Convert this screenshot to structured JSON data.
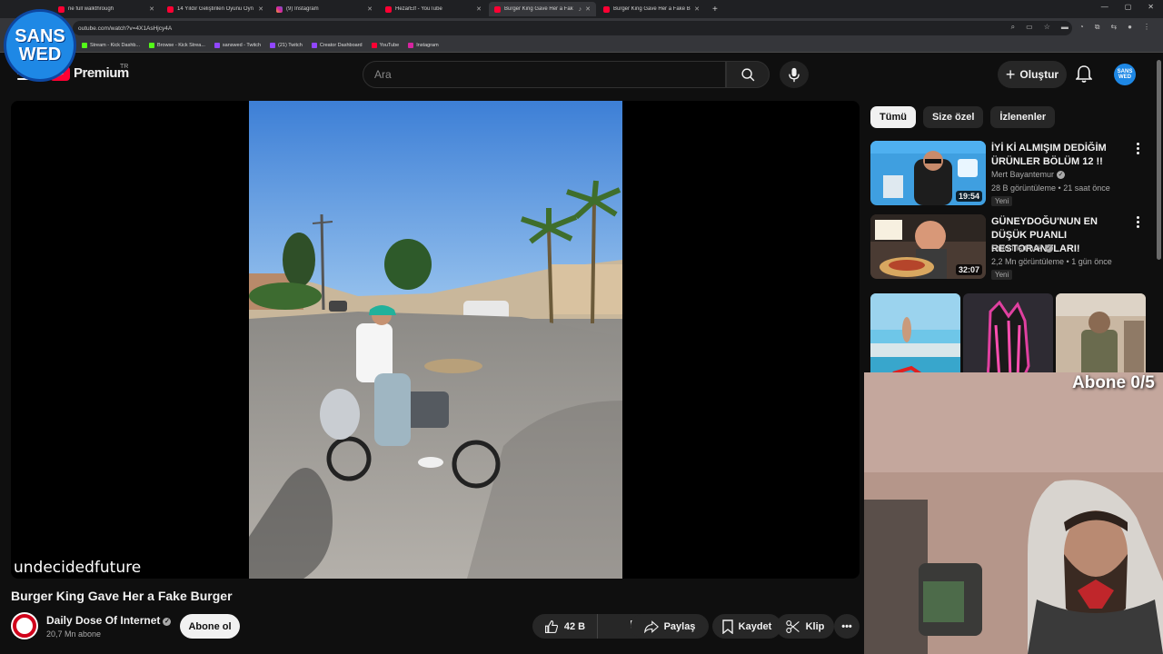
{
  "browser": {
    "tabs": [
      {
        "title": "ne full walkthrough",
        "icon": "youtube-icon"
      },
      {
        "title": "14 Yıldır Geliştirilen Oyunu Oyn",
        "icon": "youtube-icon"
      },
      {
        "title": "(9) Instagram",
        "icon": "instagram-icon"
      },
      {
        "title": "HezarElf - YouTube",
        "icon": "youtube-icon"
      },
      {
        "title": "Burger King Gave Her a Fak",
        "icon": "youtube-icon",
        "active": true
      },
      {
        "title": "Burger King Gave Her a Fake B",
        "icon": "youtube-icon"
      }
    ],
    "url": "outube.com/watch?v=4X1AsHjcy4A",
    "bookmarks": [
      {
        "label": "Stream - Kick Dashb...",
        "icon": "kick-icon"
      },
      {
        "label": "Browse - Kick Strea...",
        "icon": "kick-icon"
      },
      {
        "label": "sanswed - Twitch",
        "icon": "twitch-icon"
      },
      {
        "label": "(21) Twitch",
        "icon": "twitch-icon"
      },
      {
        "label": "Creator Dashboard",
        "icon": "twitch-icon"
      },
      {
        "label": "YouTube",
        "icon": "youtube-icon"
      },
      {
        "label": "Instagram",
        "icon": "instagram-icon"
      }
    ]
  },
  "stream_overlay": {
    "logo_line1": "SANS",
    "logo_line2": "WED",
    "subscriber_goal": "Abone 0/5"
  },
  "header": {
    "logo_text": "Premium",
    "region": "TR",
    "search_placeholder": "Ara",
    "create_label": "Oluştur",
    "avatar_line1": "SANS",
    "avatar_line2": "WED"
  },
  "video": {
    "overlay_username": "undecidedfuture",
    "title": "Burger King Gave Her a Fake Burger",
    "channel_name": "Daily Dose Of Internet",
    "subscribers": "20,7 Mn abone",
    "subscribe_label": "Abone ol",
    "likes": "42 B",
    "share_label": "Paylaş",
    "save_label": "Kaydet",
    "clip_label": "Klip"
  },
  "sidebar": {
    "chips": [
      {
        "label": "Tümü",
        "active": true
      },
      {
        "label": "Size özel",
        "active": false
      },
      {
        "label": "İzlenenler",
        "active": false
      }
    ],
    "recommendations": [
      {
        "title": "İYİ Kİ ALMIŞIM DEDİĞİM ÜRÜNLER BÖLÜM 12 !!",
        "channel": "Mert Bayantemur",
        "meta": "28 B görüntüleme • 21 saat önce",
        "badge": "Yeni",
        "duration": "19:54"
      },
      {
        "title": "GÜNEYDOĞU'NUN EN DÜŞÜK PUANLI RESTORANTLARI!",
        "channel": "Orkun Işıtmak",
        "meta": "2,2 Mn görüntüleme • 1 gün önce",
        "badge": "Yeni",
        "duration": "32:07"
      }
    ]
  }
}
